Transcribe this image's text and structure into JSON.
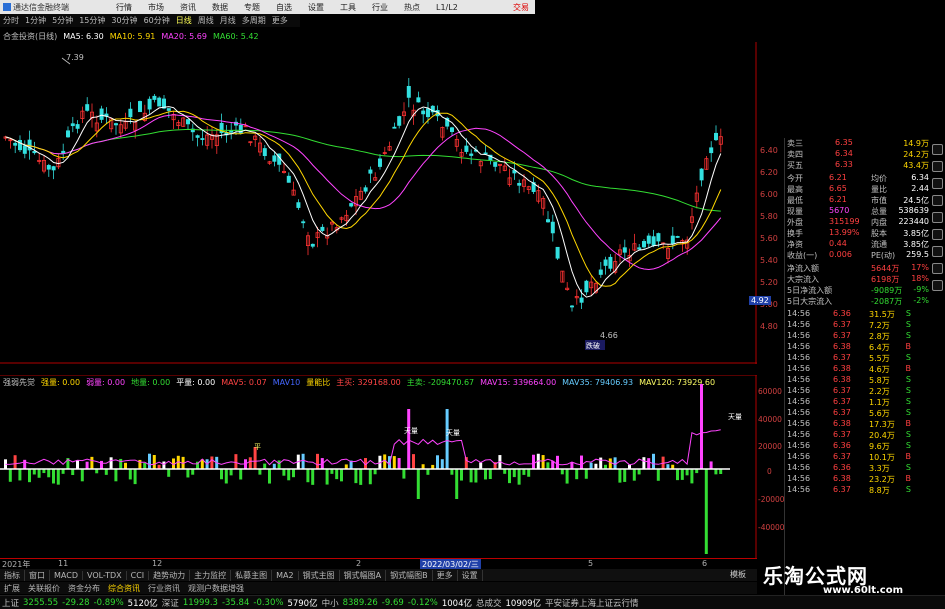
{
  "app_title": "通达信金融终端",
  "menu": [
    "行情",
    "市场",
    "资讯",
    "数据",
    "专题",
    "自选",
    "设置",
    "工具",
    "行业",
    "热点",
    "L1/L2"
  ],
  "login_label": "交易",
  "periods": [
    "分时",
    "1分钟",
    "5分钟",
    "15分钟",
    "30分钟",
    "60分钟",
    "日线",
    "周线",
    "月线",
    "多周期",
    "更多"
  ],
  "active_period": "日线",
  "stock_label": "合金投资(日线)",
  "ma_legend": [
    {
      "label": "MA5: 6.30",
      "color": "#ffffff"
    },
    {
      "label": "MA10: 5.91",
      "color": "#ffd700"
    },
    {
      "label": "MA20: 5.69",
      "color": "#ff44ff"
    },
    {
      "label": "MA60: 5.42",
      "color": "#33dd33"
    }
  ],
  "vol_legend": [
    {
      "label": "强弱先觉",
      "color": "#c0c0c0"
    },
    {
      "label": "强量: 0.00",
      "color": "#ffd700"
    },
    {
      "label": "弱量: 0.00",
      "color": "#ff44ff"
    },
    {
      "label": "地量: 0.00",
      "color": "#33dd33"
    },
    {
      "label": "平量: 0.00",
      "color": "#ffffff"
    },
    {
      "label": "MAV5: 0.07",
      "color": "#ff4444"
    },
    {
      "label": "MAV10",
      "color": "#4466ff"
    },
    {
      "label": "量能比",
      "color": "#ffd700"
    },
    {
      "label": "主买: 329168.00",
      "color": "#ff4444"
    },
    {
      "label": "主卖: -209470.67",
      "color": "#33dd33"
    },
    {
      "label": "MAV15: 339664.00",
      "color": "#ff44ff"
    },
    {
      "label": "MAV35: 79406.93",
      "color": "#66ccff"
    },
    {
      "label": "MAV120: 73929.60",
      "color": "#ffff66"
    }
  ],
  "price_high_label": "7.39",
  "price_low_label": "4.66",
  "current_price_tag": "4.92",
  "price_axis": [
    "6.40",
    "6.20",
    "6.00",
    "5.80",
    "5.60",
    "5.40",
    "5.20",
    "5.00",
    "4.80"
  ],
  "vol_axis": [
    "60000",
    "40000",
    "20000",
    "0",
    "-20000",
    "-40000"
  ],
  "time_axis": [
    "2021年",
    "11",
    "12",
    "2",
    "2022/03/02/三",
    "5",
    "6"
  ],
  "signals": {
    "low_marker": "跌破",
    "vol_peak_a": "天量",
    "vol_peak_b": "天量",
    "vol_peak_c": "天量",
    "tag": "平"
  },
  "quote_panel": {
    "asks": [
      {
        "label": "卖三",
        "price": "6.35",
        "vol": "14.9万"
      },
      {
        "label": "卖四",
        "price": "6.34",
        "vol": "24.2万"
      },
      {
        "label": "买五",
        "price": "6.33",
        "vol": "43.4万"
      }
    ],
    "stats": [
      {
        "l1": "今开",
        "v1": "6.21",
        "l2": "均价",
        "v2": "6.34"
      },
      {
        "l1": "最高",
        "v1": "6.65",
        "l2": "量比",
        "v2": "2.44"
      },
      {
        "l1": "最低",
        "v1": "6.21",
        "l2": "市值",
        "v2": "24.5亿"
      },
      {
        "l1": "现量",
        "v1": "5670",
        "l2": "总量",
        "v2": "538639"
      },
      {
        "l1": "外盘",
        "v1": "315199",
        "l2": "内盘",
        "v2": "223440"
      },
      {
        "l1": "换手",
        "v1": "13.99%",
        "l2": "股本",
        "v2": "3.85亿"
      },
      {
        "l1": "净资",
        "v1": "0.44",
        "l2": "流通",
        "v2": "3.85亿"
      },
      {
        "l1": "收益(一)",
        "v1": "0.006",
        "l2": "PE(动)",
        "v2": "259.5"
      }
    ],
    "flows": [
      {
        "label": "净流入额",
        "value": "5644万",
        "pct": "17%"
      },
      {
        "label": "大宗流入",
        "value": "6198万",
        "pct": "18%"
      },
      {
        "label": "5日净流入额",
        "value": "-9089万",
        "pct": "-9%"
      },
      {
        "label": "5日大宗流入",
        "value": "-2087万",
        "pct": "-2%"
      }
    ],
    "ticks": [
      {
        "time": "14:56",
        "price": "6.36",
        "vol": "31.5万",
        "side": "S"
      },
      {
        "time": "14:56",
        "price": "6.37",
        "vol": "7.2万",
        "side": "S"
      },
      {
        "time": "14:56",
        "price": "6.37",
        "vol": "2.8万",
        "side": "S"
      },
      {
        "time": "14:56",
        "price": "6.38",
        "vol": "6.4万",
        "side": "B"
      },
      {
        "time": "14:56",
        "price": "6.37",
        "vol": "5.5万",
        "side": "S"
      },
      {
        "time": "14:56",
        "price": "6.38",
        "vol": "4.6万",
        "side": "B"
      },
      {
        "time": "14:56",
        "price": "6.38",
        "vol": "5.8万",
        "side": "S"
      },
      {
        "time": "14:56",
        "price": "6.37",
        "vol": "2.2万",
        "side": "S"
      },
      {
        "time": "14:56",
        "price": "6.37",
        "vol": "1.1万",
        "side": "S"
      },
      {
        "time": "14:56",
        "price": "6.37",
        "vol": "5.6万",
        "side": "S"
      },
      {
        "time": "14:56",
        "price": "6.38",
        "vol": "17.3万",
        "side": "B"
      },
      {
        "time": "14:56",
        "price": "6.37",
        "vol": "20.4万",
        "side": "S"
      },
      {
        "time": "14:56",
        "price": "6.36",
        "vol": "9.6万",
        "side": "S"
      },
      {
        "time": "14:56",
        "price": "6.37",
        "vol": "10.1万",
        "side": "B"
      },
      {
        "time": "14:56",
        "price": "6.36",
        "vol": "3.3万",
        "side": "S"
      },
      {
        "time": "14:56",
        "price": "6.38",
        "vol": "23.2万",
        "side": "B"
      },
      {
        "time": "14:56",
        "price": "6.37",
        "vol": "8.8万",
        "side": "S"
      }
    ]
  },
  "indicator_tabs": [
    "指标",
    "窗口",
    "MACD",
    "VOL-TDX",
    "CCI",
    "趋势动力",
    "主力监控",
    "私募主图",
    "MA2",
    "钢式主图",
    "钢式幅图A",
    "钢式幅图B",
    "更多",
    "设置"
  ],
  "bottom_tabs": [
    "扩展",
    "关联报价",
    "资金分布",
    "综合资讯",
    "行业资讯",
    "观测户数据增强"
  ],
  "right_tab": "模板",
  "statusbar": [
    {
      "text": "上证",
      "color": "#c0c0c0"
    },
    {
      "text": "3255.55",
      "color": "#33dd33"
    },
    {
      "text": "-29.28",
      "color": "#33dd33"
    },
    {
      "text": "-0.89%",
      "color": "#33dd33"
    },
    {
      "text": "5120亿",
      "color": "#ffffff"
    },
    {
      "text": "深证",
      "color": "#c0c0c0"
    },
    {
      "text": "11999.3",
      "color": "#33dd33"
    },
    {
      "text": "-35.84",
      "color": "#33dd33"
    },
    {
      "text": "-0.30%",
      "color": "#33dd33"
    },
    {
      "text": "5790亿",
      "color": "#ffffff"
    },
    {
      "text": "中小",
      "color": "#c0c0c0"
    },
    {
      "text": "8389.26",
      "color": "#33dd33"
    },
    {
      "text": "-9.69",
      "color": "#33dd33"
    },
    {
      "text": "-0.12%",
      "color": "#33dd33"
    },
    {
      "text": "1004亿",
      "color": "#ffffff"
    },
    {
      "text": "总成交",
      "color": "#c0c0c0"
    },
    {
      "text": "10909亿",
      "color": "#ffffff"
    },
    {
      "text": "平安证券上海上证云行情",
      "color": "#c0c0c0"
    }
  ],
  "watermark": {
    "title": "乐淘公式网",
    "url": "www.60lt.com"
  },
  "colors": {
    "up": "#ff3333",
    "down": "#33e0e0",
    "ma5": "#ffffff",
    "ma10": "#ffd700",
    "ma20": "#ff44ff",
    "ma60": "#33dd33",
    "axis": "#b00000"
  }
}
